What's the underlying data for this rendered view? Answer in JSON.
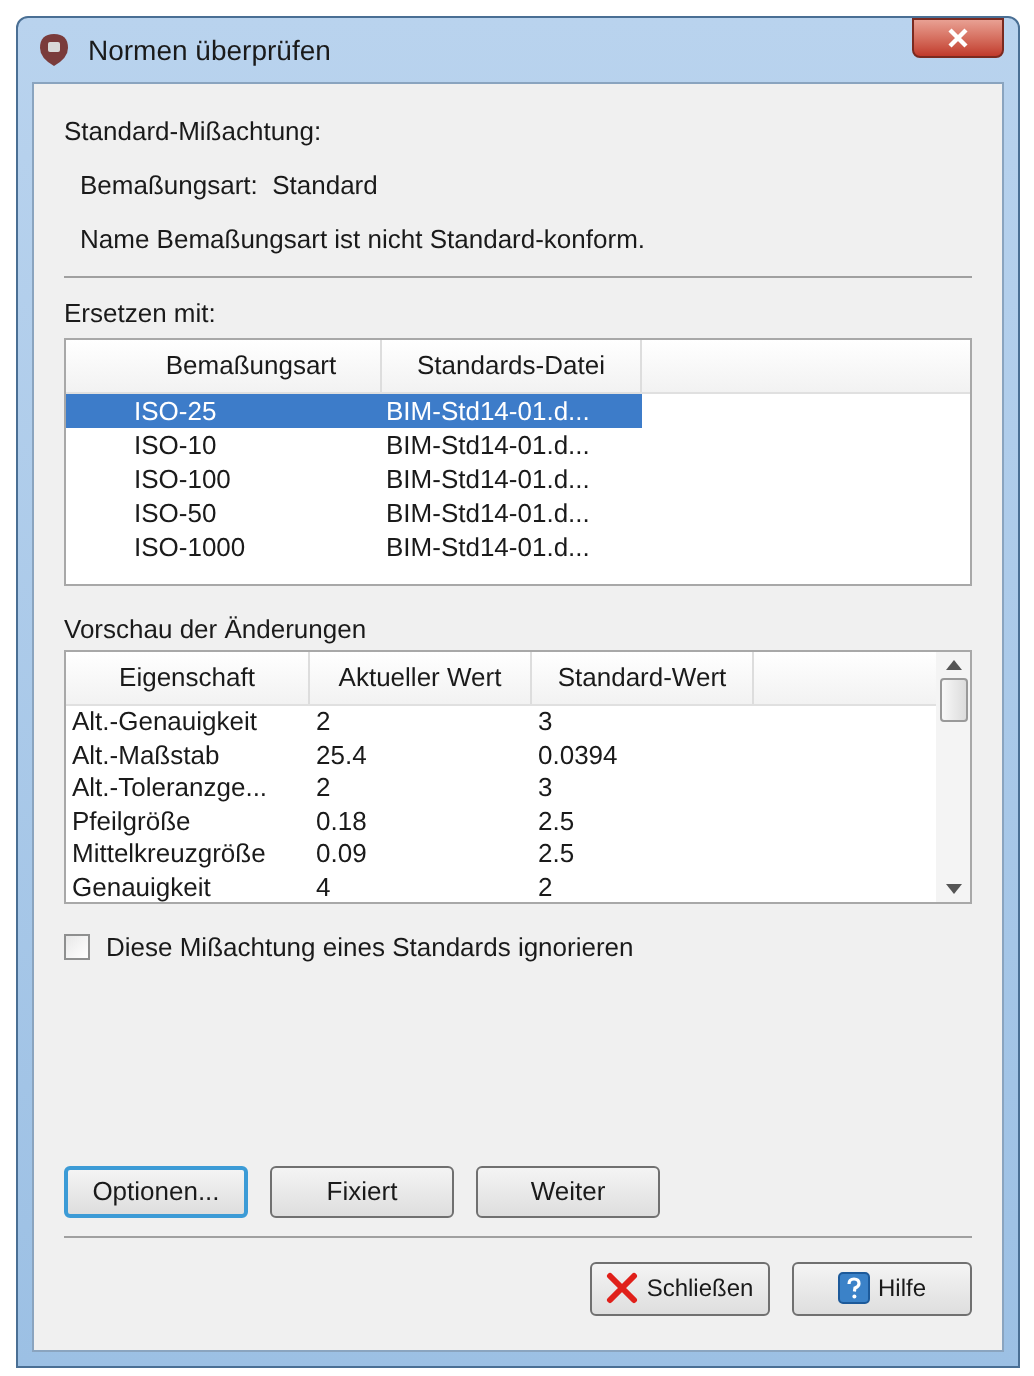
{
  "window": {
    "title": "Normen überprüfen"
  },
  "violation": {
    "heading": "Standard-Mißachtung:",
    "detail": "Bemaßungsart:  Standard",
    "message": "Name Bemaßungsart ist nicht Standard-konform."
  },
  "replace": {
    "label": "Ersetzen mit:",
    "columns": [
      "Bemaßungsart",
      "Standards-Datei"
    ],
    "rows": [
      {
        "name": "ISO-25",
        "file": "BIM-Std14-01.d...",
        "selected": true
      },
      {
        "name": "ISO-10",
        "file": "BIM-Std14-01.d...",
        "selected": false
      },
      {
        "name": "ISO-100",
        "file": "BIM-Std14-01.d...",
        "selected": false
      },
      {
        "name": "ISO-50",
        "file": "BIM-Std14-01.d...",
        "selected": false
      },
      {
        "name": "ISO-1000",
        "file": "BIM-Std14-01.d...",
        "selected": false
      }
    ]
  },
  "preview": {
    "label": "Vorschau der Änderungen",
    "columns": [
      "Eigenschaft",
      "Aktueller Wert",
      "Standard-Wert"
    ],
    "rows": [
      [
        "Alt.-Genauigkeit",
        "2",
        "3"
      ],
      [
        "Alt.-Maßstab",
        "25.4",
        "0.0394"
      ],
      [
        "Alt.-Toleranzge...",
        "2",
        "3"
      ],
      [
        "Pfeilgröße",
        "0.18",
        "2.5"
      ],
      [
        "Mittelkreuzgröße",
        "0.09",
        "2.5"
      ],
      [
        "Genauigkeit",
        "4",
        "2"
      ]
    ]
  },
  "ignore_checkbox": {
    "label": "Diese Mißachtung eines Standards ignorieren",
    "checked": false
  },
  "action_buttons": [
    {
      "label": "Optionen...",
      "focused": true
    },
    {
      "label": "Fixiert",
      "focused": false
    },
    {
      "label": "Weiter",
      "focused": false
    }
  ],
  "footer_buttons": [
    {
      "label": "Schließen",
      "kind": "close"
    },
    {
      "label": "Hilfe",
      "kind": "help"
    }
  ]
}
